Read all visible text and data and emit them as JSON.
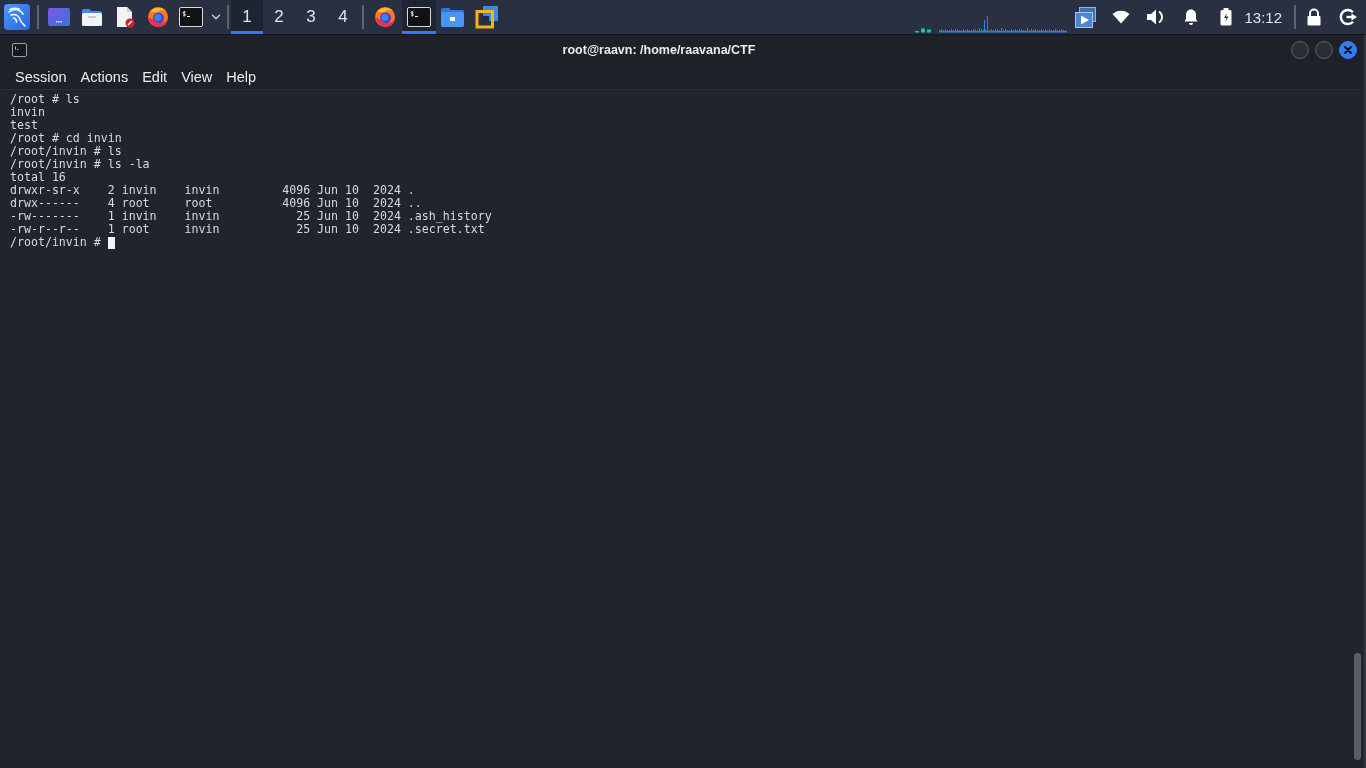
{
  "taskbar": {
    "launchers": [
      {
        "kind": "desktop"
      },
      {
        "kind": "files"
      },
      {
        "kind": "editor"
      },
      {
        "kind": "browser"
      },
      {
        "kind": "terminal"
      }
    ],
    "workspaces": [
      {
        "label": "1",
        "selected": true
      },
      {
        "label": "2",
        "selected": false
      },
      {
        "label": "3",
        "selected": false
      },
      {
        "label": "4",
        "selected": false
      }
    ],
    "tasks": [
      {
        "kind": "browser",
        "selected": false
      },
      {
        "kind": "terminal",
        "selected": true
      },
      {
        "kind": "folder",
        "selected": false
      },
      {
        "kind": "vm",
        "selected": false
      }
    ],
    "clock": "13:12"
  },
  "window": {
    "title": "root@raavn: /home/raavana/CTF"
  },
  "menu": [
    "Session",
    "Actions",
    "Edit",
    "View",
    "Help"
  ],
  "terminal": {
    "lines": [
      "/root # ls",
      "invin",
      "test",
      "/root # cd invin",
      "/root/invin # ls",
      "/root/invin # ls -la",
      "total 16",
      "drwxr-sr-x    2 invin    invin         4096 Jun 10  2024 .",
      "drwx------    4 root     root          4096 Jun 10  2024 ..",
      "-rw-------    1 invin    invin           25 Jun 10  2024 .ash_history",
      "-rw-r--r--    1 root     invin           25 Jun 10  2024 .secret.txt",
      "/root/invin # "
    ],
    "cursor": true
  }
}
